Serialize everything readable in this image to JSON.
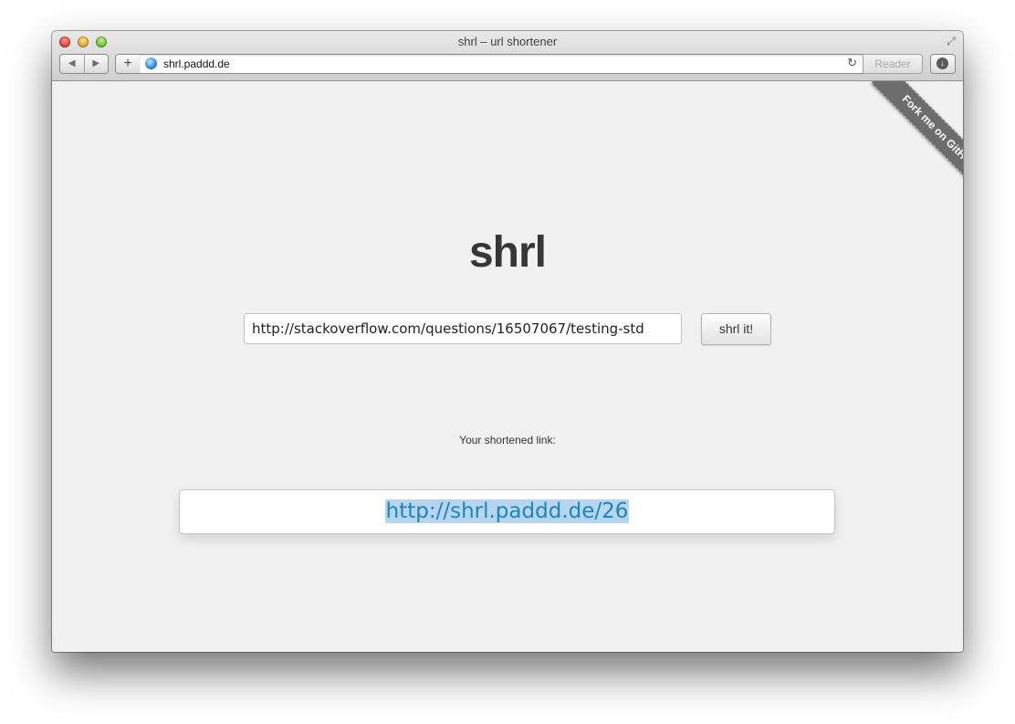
{
  "window": {
    "title": "shrl – url shortener"
  },
  "toolbar": {
    "back_icon": "◀",
    "forward_icon": "▶",
    "new_tab_icon": "+",
    "url": "shrl.paddd.de",
    "reload_icon": "↻",
    "reader_label": "Reader",
    "download_icon": "↓",
    "fullscreen_icon": "⤢"
  },
  "page": {
    "ribbon_label": "Fork me on GitHub",
    "heading": "shrl",
    "input_value": "http://stackoverflow.com/questions/16507067/testing-std",
    "submit_label": "shrl it!",
    "result_label": "Your shortened link:",
    "result_link": "http://shrl.paddd.de/26"
  },
  "colors": {
    "link": "#1f84b6",
    "selection": "#b5d5f0",
    "ribbon": "#6d6d6d"
  }
}
